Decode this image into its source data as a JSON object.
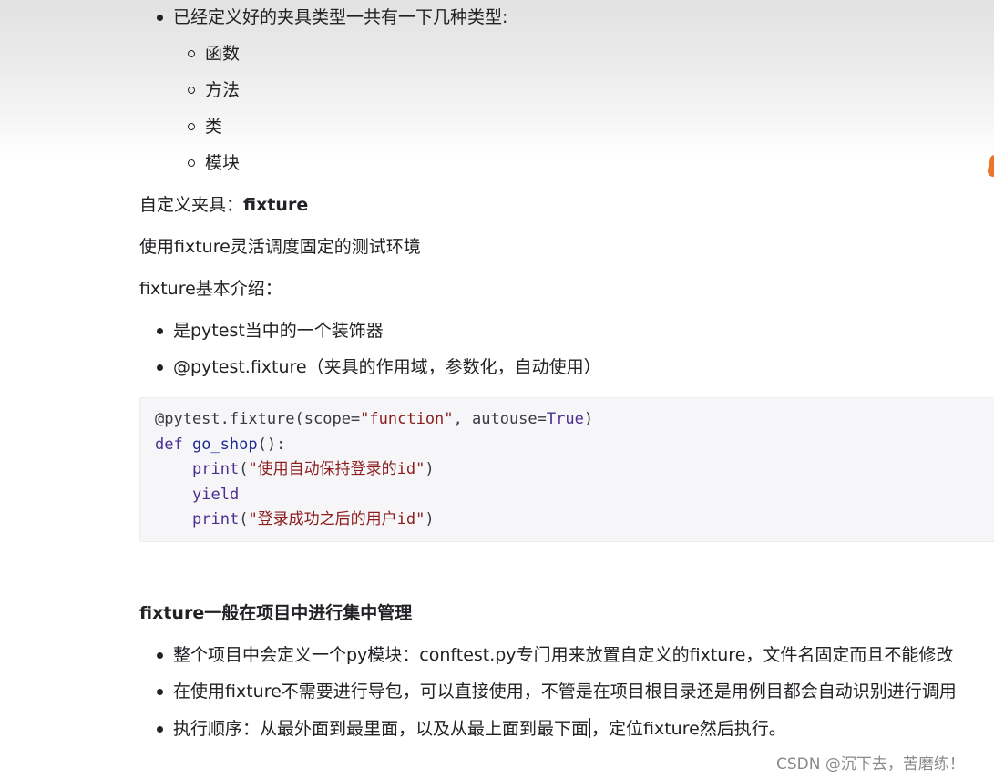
{
  "top_list": {
    "intro": "已经定义好的夹具类型一共有一下几种类型:",
    "sub_items": [
      "函数",
      "方法",
      "类",
      "模块"
    ]
  },
  "custom_fixture": {
    "label": "自定义夹具：",
    "keyword": "fixture"
  },
  "para_usage": "使用fixture灵活调度固定的测试环境",
  "para_intro": "fixture基本介绍：",
  "intro_bullets": [
    "是pytest当中的一个装饰器",
    "@pytest.fixture（夹具的作用域，参数化，自动使用）"
  ],
  "code": {
    "line1": {
      "prefix": "@pytest.fixture(scope=",
      "str1": "\"function\"",
      "mid": ", autouse=",
      "const": "True",
      "suffix": ")"
    },
    "line2": {
      "kw": "def",
      "name": " go_shop",
      "suffix": "():"
    },
    "line3": {
      "fn": "print",
      "open": "(",
      "str": "\"使用自动保持登录的id\"",
      "close": ")"
    },
    "line4": {
      "kw": "yield"
    },
    "line5": {
      "fn": "print",
      "open": "(",
      "str": "\"登录成功之后的用户id\"",
      "close": ")"
    }
  },
  "section_heading": "fixture一般在项目中进行集中管理",
  "mgmt_bullets": [
    "整个项目中会定义一个py模块：conftest.py专门用来放置自定义的fixture，文件名固定而且不能修改",
    "在使用fixture不需要进行导包，可以直接使用，不管是在项目根目录还是用例目都会自动识别进行调用"
  ],
  "last_bullet": {
    "before_cursor": "执行顺序：从最外面到最里面，以及从最上面到最下面",
    "after_cursor": "，定位fixture然后执行。"
  },
  "watermark": "CSDN @沉下去，苦磨练！",
  "colors": {
    "text": "#222226",
    "code_bg": "#f6f6f8",
    "keyword": "#4b2f8f",
    "string": "#8b1d1d",
    "watermark": "#8a8a8a",
    "accent_mark": "#e8762c"
  }
}
